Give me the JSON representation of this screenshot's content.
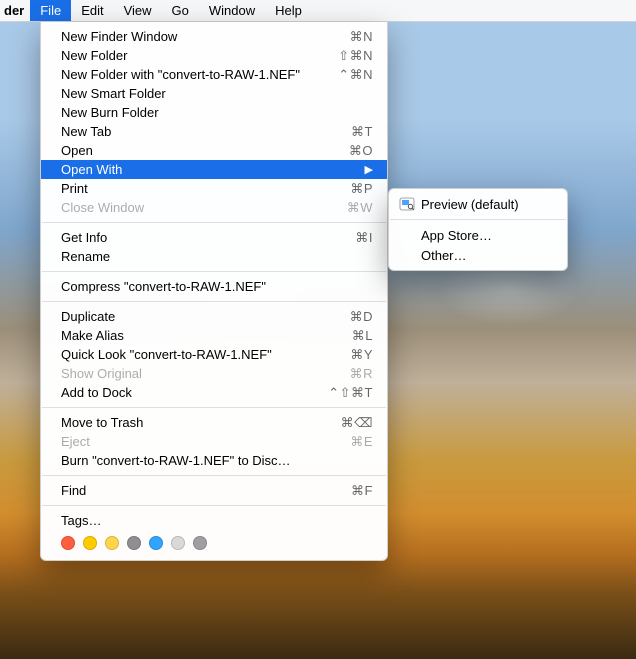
{
  "menubar": {
    "app_fragment": "der",
    "items": [
      {
        "label": "File",
        "active": true
      },
      {
        "label": "Edit"
      },
      {
        "label": "View"
      },
      {
        "label": "Go"
      },
      {
        "label": "Window"
      },
      {
        "label": "Help"
      }
    ]
  },
  "file_menu": {
    "groups": [
      [
        {
          "label": "New Finder Window",
          "shortcut": "⌘N"
        },
        {
          "label": "New Folder",
          "shortcut": "⇧⌘N"
        },
        {
          "label": "New Folder with \"convert-to-RAW-1.NEF\"",
          "shortcut": "⌃⌘N"
        },
        {
          "label": "New Smart Folder",
          "shortcut": ""
        },
        {
          "label": "New Burn Folder",
          "shortcut": ""
        },
        {
          "label": "New Tab",
          "shortcut": "⌘T"
        },
        {
          "label": "Open",
          "shortcut": "⌘O"
        },
        {
          "label": "Open With",
          "shortcut": "",
          "submenu": true,
          "selected": true
        },
        {
          "label": "Print",
          "shortcut": "⌘P"
        },
        {
          "label": "Close Window",
          "shortcut": "⌘W",
          "disabled": true
        }
      ],
      [
        {
          "label": "Get Info",
          "shortcut": "⌘I"
        },
        {
          "label": "Rename",
          "shortcut": ""
        }
      ],
      [
        {
          "label": "Compress \"convert-to-RAW-1.NEF\"",
          "shortcut": ""
        }
      ],
      [
        {
          "label": "Duplicate",
          "shortcut": "⌘D"
        },
        {
          "label": "Make Alias",
          "shortcut": "⌘L"
        },
        {
          "label": "Quick Look \"convert-to-RAW-1.NEF\"",
          "shortcut": "⌘Y"
        },
        {
          "label": "Show Original",
          "shortcut": "⌘R",
          "disabled": true
        },
        {
          "label": "Add to Dock",
          "shortcut": "⌃⇧⌘T"
        }
      ],
      [
        {
          "label": "Move to Trash",
          "shortcut": "⌘⌫"
        },
        {
          "label": "Eject",
          "shortcut": "⌘E",
          "disabled": true
        },
        {
          "label": "Burn \"convert-to-RAW-1.NEF\" to Disc…",
          "shortcut": ""
        }
      ],
      [
        {
          "label": "Find",
          "shortcut": "⌘F"
        }
      ],
      [
        {
          "label": "Tags…",
          "shortcut": "",
          "tags": true
        }
      ]
    ],
    "tag_colors": [
      "#ff5f3c",
      "#ffcc00",
      "#ffd54a",
      "#8e8e93",
      "#31a4ff",
      "#d9d9dc",
      "#9e9ea3"
    ]
  },
  "open_with_submenu": {
    "items": [
      {
        "label": "Preview (default)",
        "icon": "preview"
      },
      {
        "sep": true
      },
      {
        "label": "App Store…"
      },
      {
        "label": "Other…"
      }
    ]
  }
}
